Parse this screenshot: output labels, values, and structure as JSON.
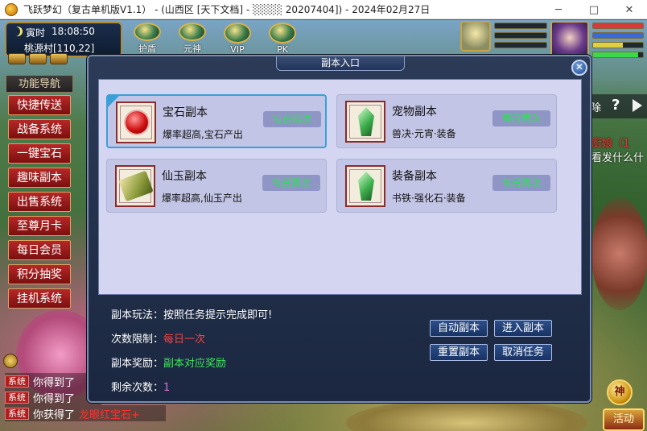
{
  "window": {
    "title": "飞跃梦幻（复古单机版V1.1） - (山西区 [天下文档] - ░░░░ 20207404]) - 2024年02月27日",
    "minimize": "─",
    "maximize": "□",
    "close": "✕"
  },
  "hud": {
    "time_label": "寅时",
    "time": "18:08:50",
    "location": "桃源村[110,22]",
    "top_skills": [
      "护盾",
      "元神",
      "VIP",
      "PK"
    ]
  },
  "nav": {
    "title": "功能导航",
    "items": [
      "快捷传送",
      "战备系统",
      "一键宝石",
      "趣味副本",
      "出售系统",
      "至尊月卡",
      "每日会员",
      "积分抽奖",
      "挂机系统"
    ]
  },
  "chat": {
    "tag": "系统",
    "lines": [
      {
        "text": "你得到了",
        "highlight": ""
      },
      {
        "text": "你得到了",
        "highlight": ""
      },
      {
        "text": "你获得了",
        "highlight": "龙眼红宝石+"
      }
    ],
    "right_line1": "厨娘（1",
    "right_line2": "看发什么什"
  },
  "right_strip": {
    "text": "除",
    "help": "?"
  },
  "god_btn": "神",
  "corner_btn": "活动",
  "dialog": {
    "title": "副本入口",
    "close_label": "✕",
    "cards": [
      {
        "name": "宝石副本",
        "desc": "爆率超高,宝石产出",
        "badge": "每日两次",
        "icon": "red-gem-icon"
      },
      {
        "name": "宠物副本",
        "desc": "兽决·元宵·装备",
        "badge": "每日两次",
        "icon": "green-crystal-icon"
      },
      {
        "name": "仙玉副本",
        "desc": "爆率超高,仙玉产出",
        "badge": "每日两次",
        "icon": "scroll-icon"
      },
      {
        "name": "装备副本",
        "desc": "书铁·强化石·装备",
        "badge": "每日两次",
        "icon": "green-crystal-icon"
      }
    ],
    "info": {
      "play_label": "副本玩法：",
      "play_value": "按照任务提示完成即可!",
      "limit_label": "次数限制：",
      "limit_value": "每日一次",
      "reward_label": "副本奖励：",
      "reward_value": "副本对应奖励",
      "remain_label": "剩余次数：",
      "remain_value": "1"
    },
    "buttons": {
      "auto": "自动副本",
      "enter": "进入副本",
      "reset": "重置副本",
      "cancel": "取消任务"
    }
  },
  "colors": {
    "nav_red": "#b52828",
    "badge_green": "#2fe05a",
    "dialog_bg": "#d3d5f1",
    "select_blue": "#3aa0d8"
  }
}
